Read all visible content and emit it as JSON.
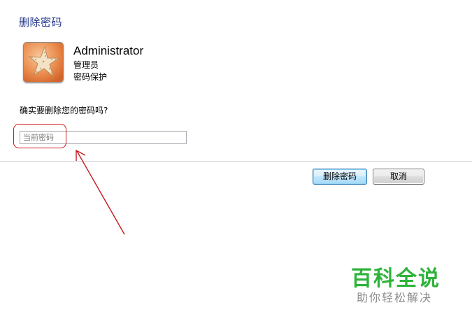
{
  "dialog": {
    "title": "删除密码"
  },
  "user": {
    "avatar_icon": "starfish-avatar-icon",
    "name": "Administrator",
    "role": "管理员",
    "protection": "密码保护"
  },
  "form": {
    "question": "确实要删除您的密码吗?",
    "current_password_placeholder": "当前密码",
    "current_password_value": ""
  },
  "buttons": {
    "delete_label": "删除密码",
    "cancel_label": "取消"
  },
  "annotation": {
    "color": "#c8181d"
  },
  "watermark": {
    "title": "百科全说",
    "subtitle": "助你轻松解决",
    "title_color": "#2db33a"
  }
}
